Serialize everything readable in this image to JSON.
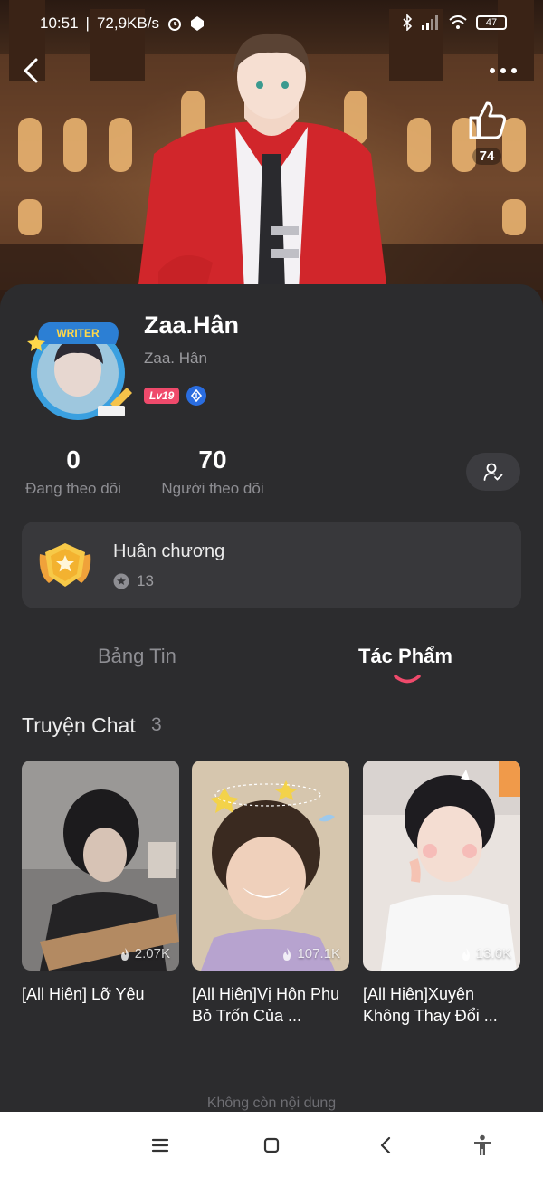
{
  "status_bar": {
    "time": "10:51",
    "speed": "72,9KB/s",
    "battery": "47"
  },
  "banner": {
    "like_count": "74"
  },
  "profile": {
    "name": "Zaa.Hân",
    "subname": "Zaa. Hân",
    "avatar_frame_label": "WRITER",
    "level": "Lv19"
  },
  "stats": {
    "following_value": "0",
    "following_label": "Đang theo dõi",
    "followers_value": "70",
    "followers_label": "Người theo dõi"
  },
  "medal": {
    "title": "Huân chương",
    "count": "13"
  },
  "tabs": {
    "feed": "Bảng Tin",
    "works": "Tác Phẩm"
  },
  "section": {
    "title": "Truyện Chat",
    "count": "3"
  },
  "stories": [
    {
      "title": "[All Hiên] Lỡ Yêu",
      "views": "2.07K"
    },
    {
      "title": "[All Hiên]Vị Hôn Phu Bỏ Trốn Của ...",
      "views": "107.1K"
    },
    {
      "title": "[All Hiên]Xuyên Không Thay Đổi ...",
      "views": "13.6K"
    }
  ],
  "end_text": "Không còn nội dung",
  "colors": {
    "background": "#2c2c2e",
    "card": "#38383b",
    "accent": "#ef4a6b"
  }
}
